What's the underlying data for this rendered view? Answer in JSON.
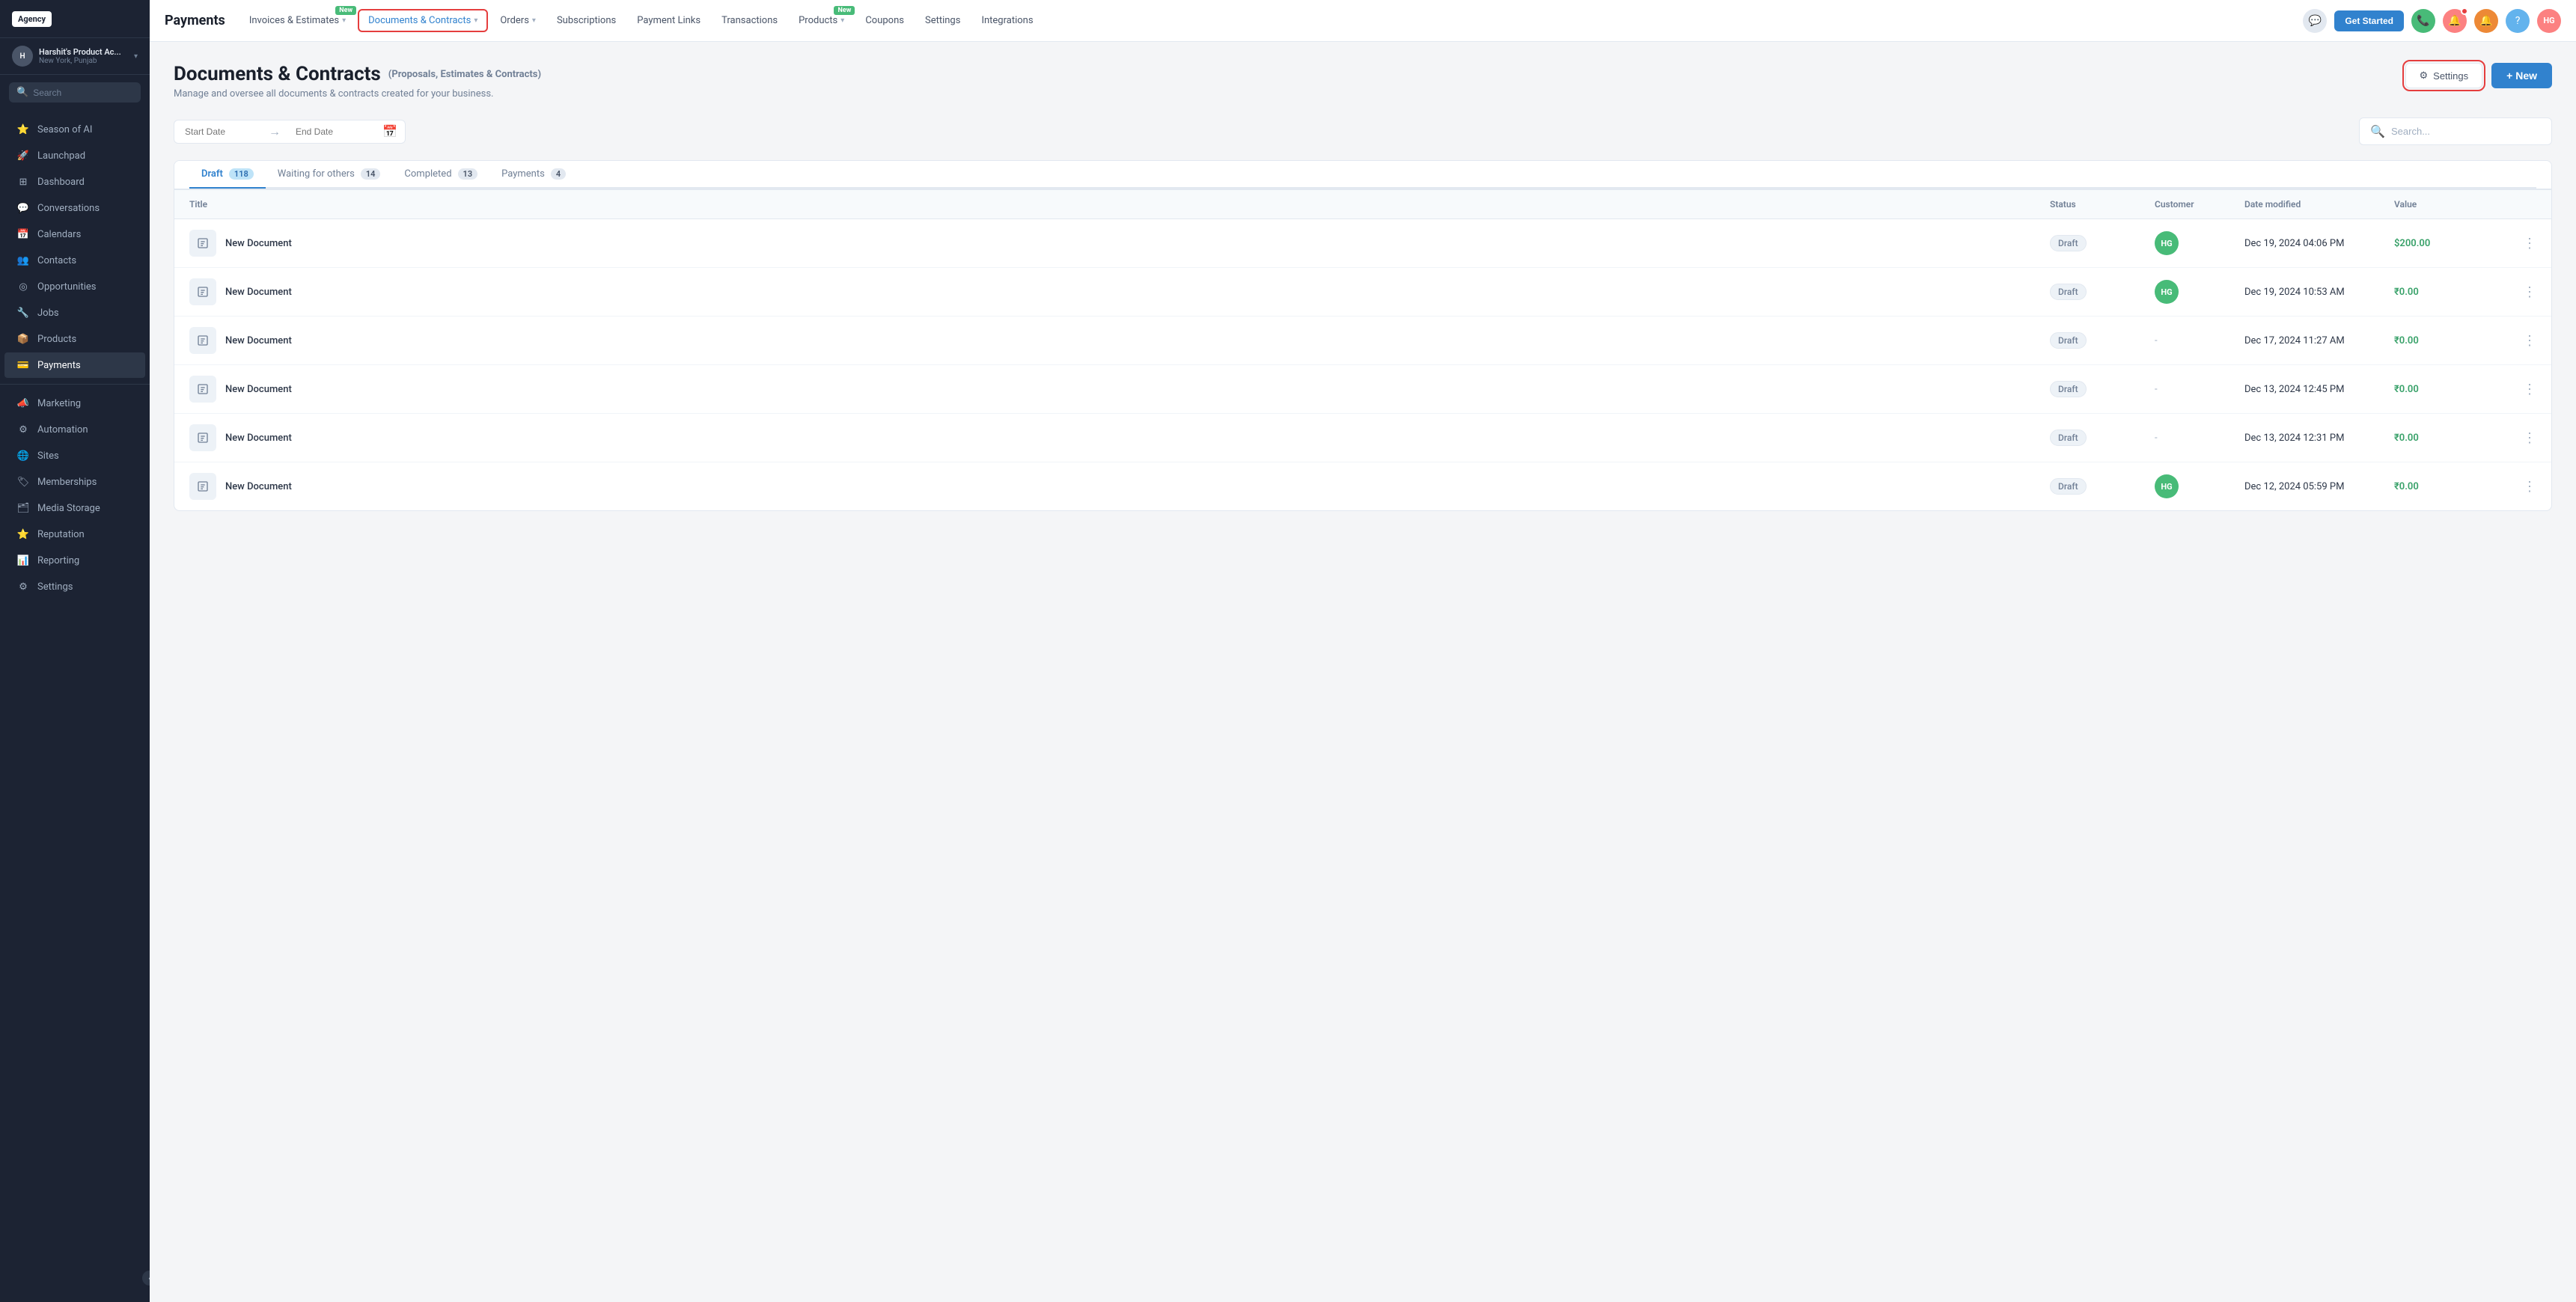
{
  "sidebar": {
    "logo": "Agency",
    "account": {
      "name": "Harshit's Product Ac...",
      "location": "New York, Punjab",
      "initials": "H"
    },
    "search_placeholder": "Search",
    "items": [
      {
        "id": "season-of-ai",
        "label": "Season of AI",
        "icon": "⭐"
      },
      {
        "id": "launchpad",
        "label": "Launchpad",
        "icon": "🚀"
      },
      {
        "id": "dashboard",
        "label": "Dashboard",
        "icon": "⊞"
      },
      {
        "id": "conversations",
        "label": "Conversations",
        "icon": "💬"
      },
      {
        "id": "calendars",
        "label": "Calendars",
        "icon": "📅"
      },
      {
        "id": "contacts",
        "label": "Contacts",
        "icon": "👥"
      },
      {
        "id": "opportunities",
        "label": "Opportunities",
        "icon": "◎"
      },
      {
        "id": "jobs",
        "label": "Jobs",
        "icon": "🔧"
      },
      {
        "id": "products",
        "label": "Products",
        "icon": "📦"
      },
      {
        "id": "payments",
        "label": "Payments",
        "icon": "💳",
        "active": true
      },
      {
        "id": "marketing",
        "label": "Marketing",
        "icon": "📣"
      },
      {
        "id": "automation",
        "label": "Automation",
        "icon": "⚙"
      },
      {
        "id": "sites",
        "label": "Sites",
        "icon": "🌐"
      },
      {
        "id": "memberships",
        "label": "Memberships",
        "icon": "🏷"
      },
      {
        "id": "media-storage",
        "label": "Media Storage",
        "icon": "🗂"
      },
      {
        "id": "reputation",
        "label": "Reputation",
        "icon": "⭐"
      },
      {
        "id": "reporting",
        "label": "Reporting",
        "icon": "📊"
      },
      {
        "id": "settings",
        "label": "Settings",
        "icon": "⚙"
      }
    ]
  },
  "topnav": {
    "title": "Payments",
    "items": [
      {
        "id": "invoices-estimates",
        "label": "Invoices & Estimates",
        "has_dropdown": true,
        "badge": ""
      },
      {
        "id": "documents-contracts",
        "label": "Documents & Contracts",
        "has_dropdown": true,
        "active": true,
        "badge": ""
      },
      {
        "id": "orders",
        "label": "Orders",
        "has_dropdown": true,
        "badge": ""
      },
      {
        "id": "subscriptions",
        "label": "Subscriptions",
        "has_dropdown": false,
        "badge": ""
      },
      {
        "id": "payment-links",
        "label": "Payment Links",
        "has_dropdown": false,
        "badge": ""
      },
      {
        "id": "transactions",
        "label": "Transactions",
        "has_dropdown": false,
        "badge": ""
      },
      {
        "id": "products",
        "label": "Products",
        "has_dropdown": true,
        "badge": "New"
      },
      {
        "id": "coupons",
        "label": "Coupons",
        "has_dropdown": false,
        "badge": ""
      },
      {
        "id": "settings",
        "label": "Settings",
        "has_dropdown": false,
        "badge": ""
      },
      {
        "id": "integrations",
        "label": "Integrations",
        "has_dropdown": false,
        "badge": ""
      }
    ],
    "new_badge_label_invoices": "New",
    "new_badge_label_products": "New",
    "actions": {
      "get_started": "Get Started",
      "avatar_initials": "HG"
    }
  },
  "page": {
    "title": "Documents & Contracts",
    "title_sub": "(Proposals, Estimates & Contracts)",
    "subtitle": "Manage and oversee all documents & contracts created for your business.",
    "settings_label": "Settings",
    "new_label": "+ New"
  },
  "filters": {
    "start_date_placeholder": "Start Date",
    "end_date_placeholder": "End Date",
    "search_placeholder": "Search..."
  },
  "tabs": [
    {
      "id": "draft",
      "label": "Draft",
      "count": "118",
      "active": true
    },
    {
      "id": "waiting-for-others",
      "label": "Waiting for others",
      "count": "14",
      "active": false
    },
    {
      "id": "completed",
      "label": "Completed",
      "count": "13",
      "active": false
    },
    {
      "id": "payments",
      "label": "Payments",
      "count": "4",
      "active": false
    }
  ],
  "table": {
    "headers": [
      "Title",
      "Status",
      "Customer",
      "Date modified",
      "Value",
      ""
    ],
    "rows": [
      {
        "title": "New Document",
        "status": "Draft",
        "customer_initials": "HG",
        "customer_bg": "#48bb78",
        "date_modified": "Dec 19, 2024 04:06 PM",
        "value": "$200.00",
        "value_color": "green"
      },
      {
        "title": "New Document",
        "status": "Draft",
        "customer_initials": "HG",
        "customer_bg": "#48bb78",
        "date_modified": "Dec 19, 2024 10:53 AM",
        "value": "₹0.00",
        "value_color": "green"
      },
      {
        "title": "New Document",
        "status": "Draft",
        "customer_initials": null,
        "customer_bg": null,
        "date_modified": "Dec 17, 2024 11:27 AM",
        "value": "₹0.00",
        "value_color": "green"
      },
      {
        "title": "New Document",
        "status": "Draft",
        "customer_initials": null,
        "customer_bg": null,
        "date_modified": "Dec 13, 2024 12:45 PM",
        "value": "₹0.00",
        "value_color": "green"
      },
      {
        "title": "New Document",
        "status": "Draft",
        "customer_initials": null,
        "customer_bg": null,
        "date_modified": "Dec 13, 2024 12:31 PM",
        "value": "₹0.00",
        "value_color": "green"
      },
      {
        "title": "New Document",
        "status": "Draft",
        "customer_initials": "HG",
        "customer_bg": "#48bb78",
        "date_modified": "Dec 12, 2024 05:59 PM",
        "value": "₹0.00",
        "value_color": "green"
      }
    ]
  }
}
